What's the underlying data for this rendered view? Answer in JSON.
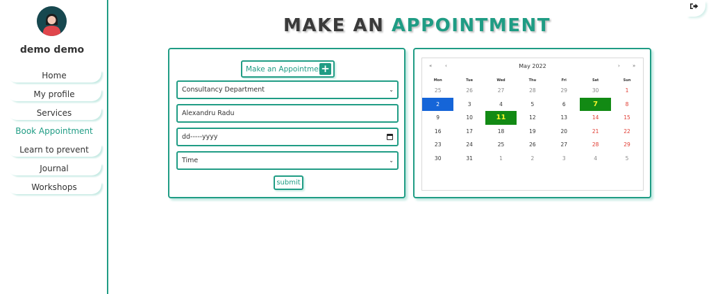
{
  "user": {
    "name": "demo demo"
  },
  "sidebar": {
    "items": [
      {
        "label": "Home",
        "active": false
      },
      {
        "label": "My profile",
        "active": false
      },
      {
        "label": "Services",
        "active": false
      },
      {
        "label": "Book Appointment",
        "active": true
      },
      {
        "label": "Learn to prevent",
        "active": false
      },
      {
        "label": "Journal",
        "active": false
      },
      {
        "label": "Workshops",
        "active": false
      }
    ]
  },
  "header": {
    "title_part1": "MAKE AN",
    "title_part2": "APPOINTMENT"
  },
  "form": {
    "make_button_label": "Make an Appointment",
    "department_value": "Consultancy Department",
    "name_value": "Alexandru Radu",
    "date_placeholder": "dd-----yyyy",
    "time_value": "Time",
    "submit_label": "submit"
  },
  "calendar": {
    "month": "May 2022",
    "prev_year": "«",
    "prev_month": "‹",
    "next_month": "›",
    "next_year": "»",
    "weekdays": [
      "Mon",
      "Tue",
      "Wed",
      "Thu",
      "Fri",
      "Sat",
      "Sun"
    ],
    "weeks": [
      [
        {
          "d": "25",
          "s": "muted"
        },
        {
          "d": "26",
          "s": "muted"
        },
        {
          "d": "27",
          "s": "muted"
        },
        {
          "d": "28",
          "s": "muted"
        },
        {
          "d": "29",
          "s": "muted"
        },
        {
          "d": "30",
          "s": "muted"
        },
        {
          "d": "1",
          "s": "weekend"
        }
      ],
      [
        {
          "d": "2",
          "s": "today"
        },
        {
          "d": "3",
          "s": ""
        },
        {
          "d": "4",
          "s": ""
        },
        {
          "d": "5",
          "s": ""
        },
        {
          "d": "6",
          "s": ""
        },
        {
          "d": "7",
          "s": "event"
        },
        {
          "d": "8",
          "s": "weekend"
        }
      ],
      [
        {
          "d": "9",
          "s": ""
        },
        {
          "d": "10",
          "s": ""
        },
        {
          "d": "11",
          "s": "event"
        },
        {
          "d": "12",
          "s": ""
        },
        {
          "d": "13",
          "s": ""
        },
        {
          "d": "14",
          "s": "weekend"
        },
        {
          "d": "15",
          "s": "weekend"
        }
      ],
      [
        {
          "d": "16",
          "s": ""
        },
        {
          "d": "17",
          "s": ""
        },
        {
          "d": "18",
          "s": ""
        },
        {
          "d": "19",
          "s": ""
        },
        {
          "d": "20",
          "s": ""
        },
        {
          "d": "21",
          "s": "weekend"
        },
        {
          "d": "22",
          "s": "weekend"
        }
      ],
      [
        {
          "d": "23",
          "s": ""
        },
        {
          "d": "24",
          "s": ""
        },
        {
          "d": "25",
          "s": ""
        },
        {
          "d": "26",
          "s": ""
        },
        {
          "d": "27",
          "s": ""
        },
        {
          "d": "28",
          "s": "weekend"
        },
        {
          "d": "29",
          "s": "weekend"
        }
      ],
      [
        {
          "d": "30",
          "s": ""
        },
        {
          "d": "31",
          "s": ""
        },
        {
          "d": "1",
          "s": "muted"
        },
        {
          "d": "2",
          "s": "muted"
        },
        {
          "d": "3",
          "s": "muted"
        },
        {
          "d": "4",
          "s": "muted"
        },
        {
          "d": "5",
          "s": "muted"
        }
      ]
    ]
  },
  "icons": {
    "logout": "logout-icon",
    "add": "plus-icon",
    "avatar": "user-avatar-icon"
  },
  "colors": {
    "accent": "#1f9c84",
    "today": "#1565d8",
    "event": "#128a14",
    "event_text": "#f5f52a",
    "weekend": "#e0392f"
  }
}
